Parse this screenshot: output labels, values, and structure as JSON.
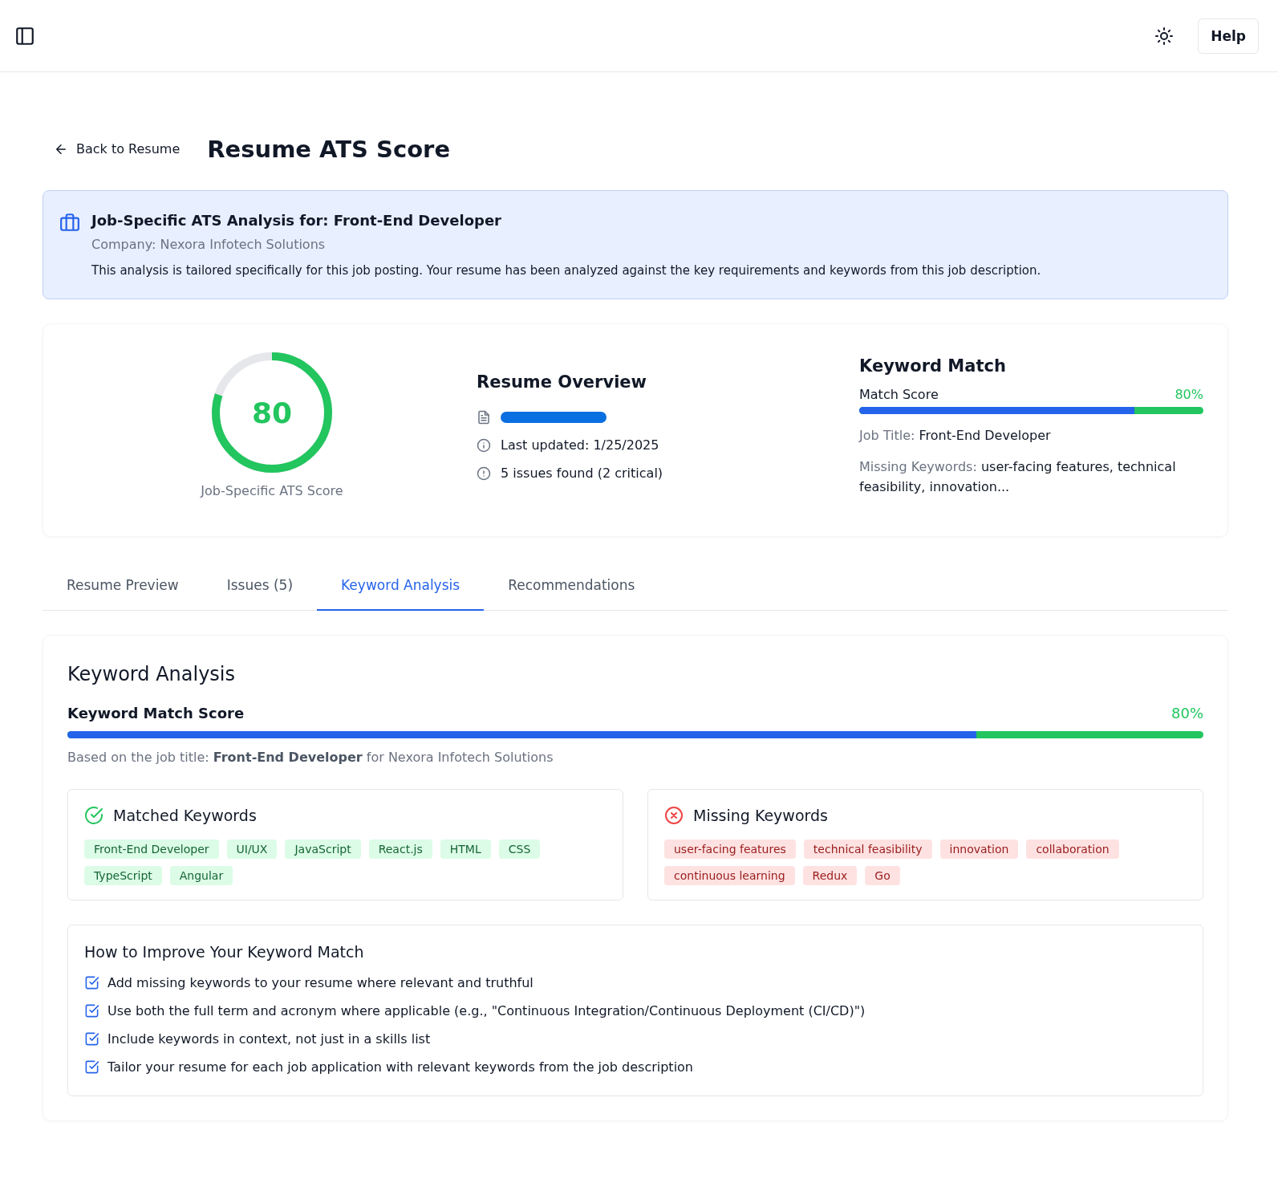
{
  "header": {
    "help_button": "Help"
  },
  "back_link": "Back to Resume",
  "page_title": "Resume ATS Score",
  "job_banner": {
    "title": "Job-Specific ATS Analysis for: Front-End Developer",
    "company": "Company: Nexora Infotech Solutions",
    "description": "This analysis is tailored specifically for this job posting. Your resume has been analyzed against the key requirements and keywords from this job description."
  },
  "score": {
    "value": "80",
    "level": 0.8,
    "label": "Job-Specific ATS Score"
  },
  "overview": {
    "title": "Resume Overview",
    "lines": [
      {
        "kind": "file"
      },
      {
        "kind": "info",
        "text": "Last updated: 1/25/2025"
      },
      {
        "kind": "alert",
        "text": "5 issues found (2 critical)"
      }
    ]
  },
  "keyword_match": {
    "title": "Keyword Match",
    "score_label": "Match Score",
    "score_text": "80%",
    "level": 0.8,
    "job_title_label": "Job Title:",
    "job_title": "Front-End Developer",
    "missing_label": "Missing Keywords:",
    "missing": "user-facing features, technical feasibility, innovation..."
  },
  "tabs": [
    {
      "label": "Resume Preview",
      "selected": false
    },
    {
      "label": "Issues (5)",
      "selected": false
    },
    {
      "label": "Keyword Analysis",
      "selected": true
    },
    {
      "label": "Recommendations",
      "selected": false
    }
  ],
  "keyword_analysis": {
    "title": "Keyword Analysis",
    "score_label": "Keyword Match Score",
    "score_text": "80%",
    "level": 0.8,
    "basis": "Based on the job title: **Front-End Developer** for Nexora Infotech Solutions",
    "groups": [
      {
        "kind": "matched",
        "title": "Matched Keywords",
        "keywords": [
          "Front-End Developer",
          "UI/UX",
          "JavaScript",
          "React.js",
          "HTML",
          "CSS",
          "TypeScript",
          "Angular"
        ]
      },
      {
        "kind": "missing",
        "title": "Missing Keywords",
        "keywords": [
          "user-facing features",
          "technical feasibility",
          "innovation",
          "collaboration",
          "continuous learning",
          "Redux",
          "Go"
        ]
      }
    ],
    "tips_title": "How to Improve Your Keyword Match",
    "tips": [
      "Add missing keywords to your resume where relevant and truthful",
      "Use both the full term and acronym where applicable (e.g., \"Continuous Integration/Continuous Deployment (CI/CD)\")",
      "Include keywords in context, not just in a skills list",
      "Tailor your resume for each job application with relevant keywords from the job description"
    ]
  }
}
